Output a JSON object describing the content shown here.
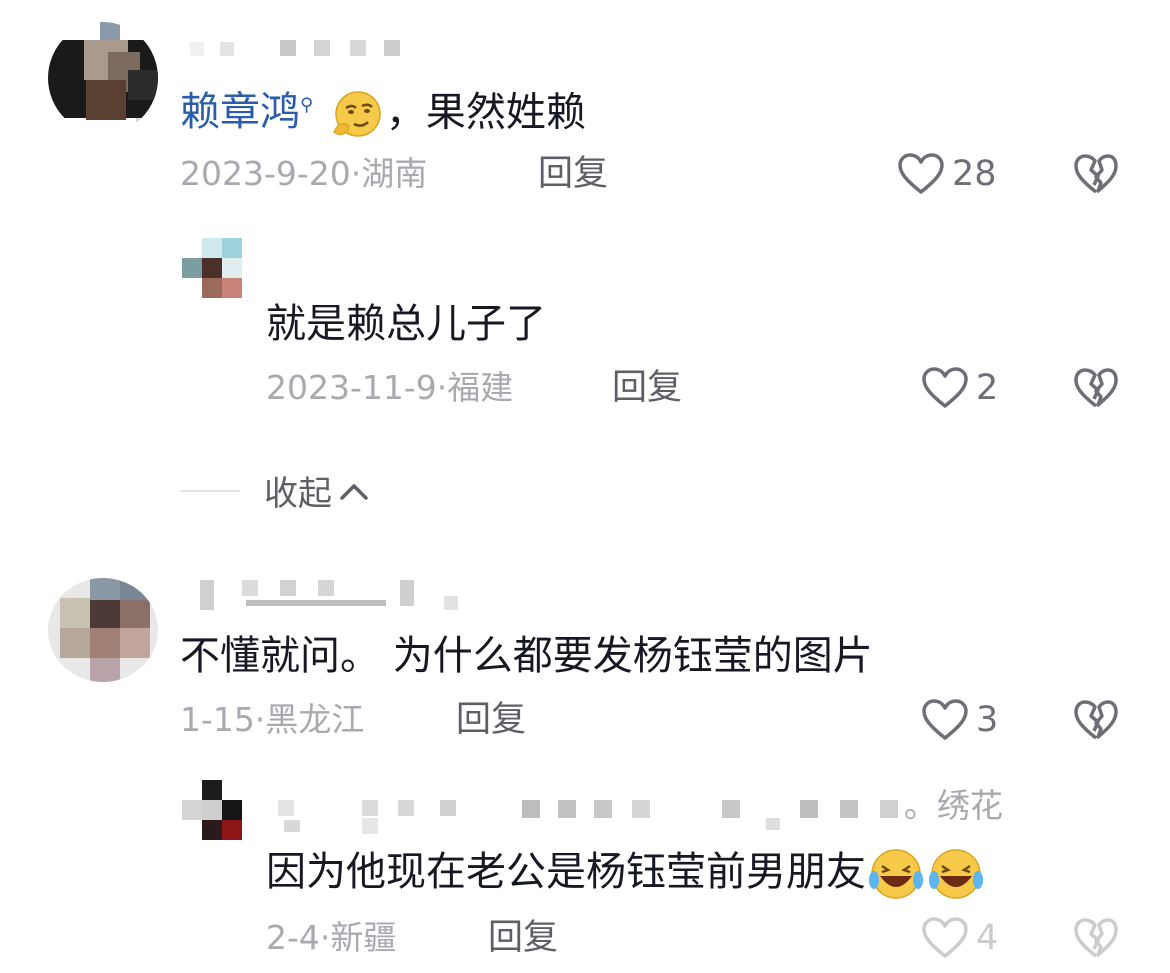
{
  "comments": [
    {
      "mention": "赖章鸿",
      "text": "，果然姓赖",
      "date": "2023-9-20",
      "location": "湖南",
      "reply_label": "回复",
      "likes": "28",
      "replies": [
        {
          "text": "就是赖总儿子了",
          "date": "2023-11-9",
          "location": "福建",
          "reply_label": "回复",
          "likes": "2"
        }
      ],
      "collapse_label": "收起"
    },
    {
      "text": "不懂就问。 为什么都要发杨钰莹的图片",
      "date": "1-15",
      "location": "黑龙江",
      "reply_label": "回复",
      "likes": "3",
      "replies": [
        {
          "name_suffix": "。绣花",
          "text": "因为他现在老公是杨钰莹前男朋友",
          "date": "2-4",
          "location": "新疆",
          "reply_label": "回复",
          "likes": "4"
        }
      ]
    }
  ],
  "icons": {
    "like": "heart-outline-icon",
    "dislike": "broken-heart-icon",
    "collapse": "chevron-up-icon",
    "emoji_1": "thinking-smirk-emoji",
    "emoji_2": "laugh-cry-emoji"
  },
  "colors": {
    "mention": "#2b5da8",
    "text": "#161823",
    "meta": "#a9aab0",
    "action": "#5e5f66"
  }
}
